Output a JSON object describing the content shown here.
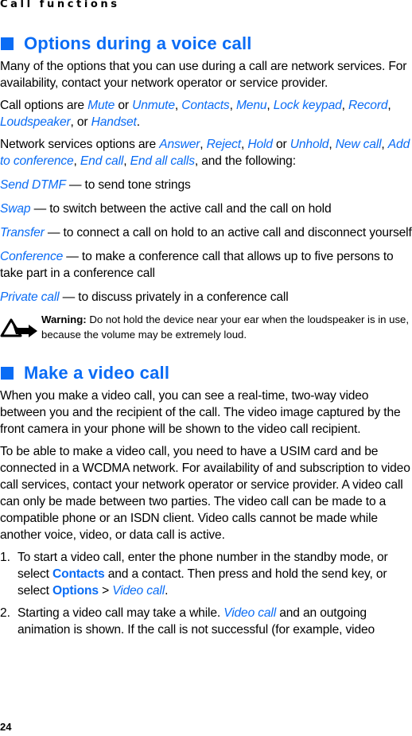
{
  "running_head": "Call functions",
  "page_number": "24",
  "accent_color": "#0a6cf5",
  "section1": {
    "title": "Options during a voice call",
    "intro": "Many of the options that you can use during a call are network services. For availability, contact your network operator or service provider.",
    "call_options": {
      "prefix": "Call options are ",
      "mute": "Mute",
      "or1": " or ",
      "unmute": "Unmute",
      "sep1": ", ",
      "contacts": "Contacts",
      "sep2": ", ",
      "menu": "Menu",
      "sep3": ", ",
      "lock_keypad": "Lock keypad",
      "sep4": ", ",
      "record": "Record",
      "sep5": ", ",
      "loudspeaker": "Loudspeaker",
      "or2": ", or ",
      "handset": "Handset",
      "end": "."
    },
    "network_options": {
      "prefix": "Network services options are ",
      "answer": "Answer",
      "sep1": ", ",
      "reject": "Reject",
      "sep2": ", ",
      "hold": "Hold",
      "or1": " or ",
      "unhold": "Unhold",
      "sep3": ", ",
      "new_call": "New call",
      "sep4": ", ",
      "add_to_conference": "Add to conference",
      "sep5": ", ",
      "end_call": "End call",
      "sep6": ", ",
      "end_all_calls": "End all calls",
      "suffix": ", and the following:"
    },
    "definitions": [
      {
        "term": "Send DTMF",
        "desc": " — to send tone strings"
      },
      {
        "term": "Swap",
        "desc": " — to switch between the active call and the call on hold"
      },
      {
        "term": "Transfer",
        "desc": " — to connect a call on hold to an active call and disconnect yourself"
      },
      {
        "term": "Conference",
        "desc": " — to make a conference call that allows up to five persons to take part in a conference call"
      },
      {
        "term": "Private call",
        "desc": " — to discuss privately in a conference call"
      }
    ],
    "warning": {
      "label": "Warning:",
      "text": " Do not hold the device near your ear when the loudspeaker is in use, because the volume may be extremely loud."
    }
  },
  "section2": {
    "title": "Make a video call",
    "para1": "When you make a video call, you can see a real-time, two-way video between you and the recipient of the call. The video image captured by the front camera in your phone will be shown to the video call recipient.",
    "para2": "To be able to make a video call, you need to have a USIM card and be connected in a WCDMA network. For availability of and subscription to video call services, contact your network operator or service provider. A video call can only be made between two parties. The video call can be made to a compatible phone or an ISDN client. Video calls cannot be made while another voice, video, or data call is active.",
    "steps": [
      {
        "num": "1.",
        "a": "To start a video call, enter the phone number in the standby mode, or select ",
        "contacts": "Contacts",
        "b": " and a contact. Then press and hold the send key, or select ",
        "options": "Options",
        "c": " > ",
        "video_call": "Video call",
        "d": "."
      },
      {
        "num": "2.",
        "a": "Starting a video call may take a while. ",
        "video_call": "Video call",
        "b": " and an outgoing animation is shown. If the call is not successful (for example, video"
      }
    ]
  }
}
